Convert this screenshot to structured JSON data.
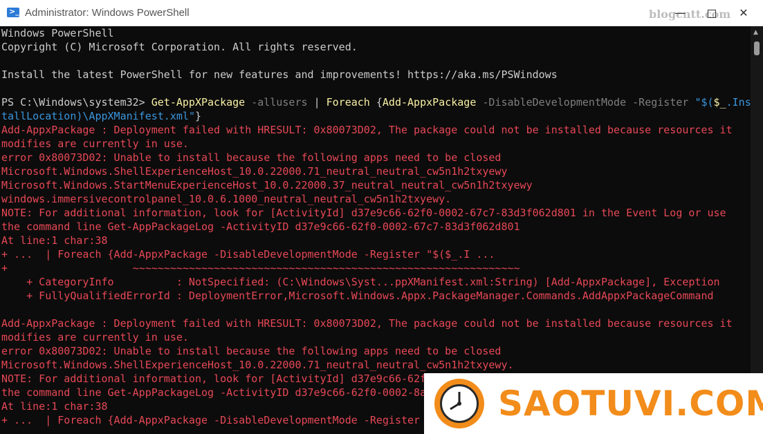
{
  "window": {
    "title": "Administrator: Windows PowerShell",
    "watermark": "blogcntt.com",
    "minimize": "—",
    "close": "✕"
  },
  "terminal": {
    "banner1": "Windows PowerShell",
    "banner2": "Copyright (C) Microsoft Corporation. All rights reserved.",
    "install": "Install the latest PowerShell for new features and improvements! https://aka.ms/PSWindows",
    "cmd": {
      "prompt": "PS C:\\Windows\\system32> ",
      "get": "Get-AppXPackage",
      "allusers": " -allusers ",
      "pipe": "| ",
      "foreach": "Foreach ",
      "brace": "{",
      "add": "Add-AppxPackage",
      "params": " -DisableDevelopmentMode -Register ",
      "str1": "\"$(",
      "var1": "$_",
      "str2": ".Ins",
      "str3": "tallLocation)",
      "path": "\\AppXManifest.xml",
      "str4": "\"",
      "end": "}"
    },
    "errors": [
      "Add-AppxPackage : Deployment failed with HRESULT: 0x80073D02, The package could not be installed because resources it",
      "modifies are currently in use.",
      "error 0x80073D02: Unable to install because the following apps need to be closed",
      "Microsoft.Windows.ShellExperienceHost_10.0.22000.71_neutral_neutral_cw5n1h2txyewy",
      "Microsoft.Windows.StartMenuExperienceHost_10.0.22000.37_neutral_neutral_cw5n1h2txyewy",
      "windows.immersivecontrolpanel_10.0.6.1000_neutral_neutral_cw5n1h2txyewy.",
      "NOTE: For additional information, look for [ActivityId] d37e9c66-62f0-0002-67c7-83d3f062d801 in the Event Log or use",
      "the command line Get-AppPackageLog -ActivityID d37e9c66-62f0-0002-67c7-83d3f062d801",
      "At line:1 char:38",
      "+ ...  | Foreach {Add-AppxPackage -DisableDevelopmentMode -Register \"$($_.I ...",
      "+                    ~~~~~~~~~~~~~~~~~~~~~~~~~~~~~~~~~~~~~~~~~~~~~~~~~~~~~~~~~~~~~~",
      "    + CategoryInfo          : NotSpecified: (C:\\Windows\\Syst...ppXManifest.xml:String) [Add-AppxPackage], Exception",
      "    + FullyQualifiedErrorId : DeploymentError,Microsoft.Windows.Appx.PackageManager.Commands.AddAppxPackageCommand",
      "",
      "Add-AppxPackage : Deployment failed with HRESULT: 0x80073D02, The package could not be installed because resources it",
      "modifies are currently in use.",
      "error 0x80073D02: Unable to install because the following apps need to be closed",
      "Microsoft.Windows.ShellExperienceHost_10.0.22000.71_neutral_neutral_cw5n1h2txyewy.",
      "NOTE: For additional information, look for [ActivityId] d37e9c66-62f",
      "the command line Get-AppPackageLog -ActivityID d37e9c66-62f0-0002-8a",
      "At line:1 char:38",
      "+ ...  | Foreach {Add-AppxPackage -DisableDevelopmentMode -Register"
    ]
  },
  "logo": {
    "text": "SAOTUVI.COM"
  },
  "colors": {
    "terminal_bg": "#0c0c0c",
    "error_red": "#e74856",
    "command_yellow": "#f9f1a5",
    "param_gray": "#7f7f7f",
    "string_blue": "#3a96dd",
    "logo_orange": "#f28c1a"
  }
}
